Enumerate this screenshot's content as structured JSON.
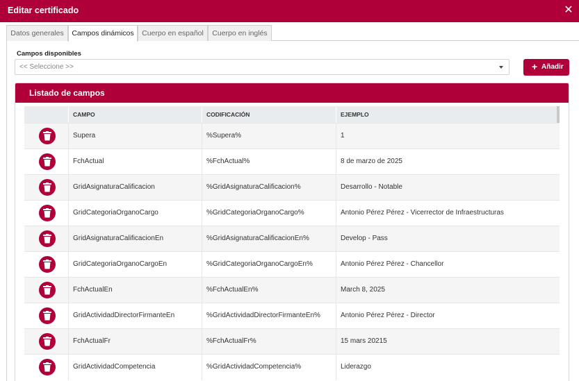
{
  "window": {
    "title": "Editar certificado",
    "close_glyph": "✕"
  },
  "tabs": [
    {
      "label": "Datos generales",
      "active": false
    },
    {
      "label": "Campos dinámicos",
      "active": true
    },
    {
      "label": "Cuerpo en español",
      "active": false
    },
    {
      "label": "Cuerpo en inglés",
      "active": false
    }
  ],
  "campos": {
    "label": "Campos disponibles",
    "selected": "<< Seleccione >>",
    "add_label": "Añadir",
    "add_icon": "plus-icon"
  },
  "listado": {
    "title": "Listado de campos",
    "columns": [
      "CAMPO",
      "CODIFICACIÓN",
      "EJEMPLO"
    ],
    "rows": [
      {
        "campo": "Supera",
        "codificacion": "%Supera%",
        "ejemplo": "1"
      },
      {
        "campo": "FchActual",
        "codificacion": "%FchActual%",
        "ejemplo": "8 de marzo de 2025"
      },
      {
        "campo": "GridAsignaturaCalificacion",
        "codificacion": "%GridAsignaturaCalificacion%",
        "ejemplo": "Desarrollo - Notable"
      },
      {
        "campo": "GridCategoriaOrganoCargo",
        "codificacion": "%GridCategoriaOrganoCargo%",
        "ejemplo": "Antonio Pérez Pérez - Vicerrector de Infraestructuras"
      },
      {
        "campo": "GridAsignaturaCalificacionEn",
        "codificacion": "%GridAsignaturaCalificacionEn%",
        "ejemplo": "Develop - Pass"
      },
      {
        "campo": "GridCategoriaOrganoCargoEn",
        "codificacion": "%GridCategoriaOrganoCargoEn%",
        "ejemplo": "Antonio Pérez Pérez - Chancellor"
      },
      {
        "campo": "FchActualEn",
        "codificacion": "%FchActualEn%",
        "ejemplo": "March 8, 2025"
      },
      {
        "campo": "GridActividadDirectorFirmanteEn",
        "codificacion": "%GridActividadDirectorFirmanteEn%",
        "ejemplo": "Antonio Pérez Pérez - Director"
      },
      {
        "campo": "FchActualFr",
        "codificacion": "%FchActualFr%",
        "ejemplo": "15 mars 20215"
      },
      {
        "campo": "GridActividadCompetencia",
        "codificacion": "%GridActividadCompetencia%",
        "ejemplo": "Liderazgo"
      }
    ],
    "delete_icon": "trash-icon"
  },
  "colors": {
    "brand": "#b0003a",
    "header_bg": "#e9ecef",
    "row_alt": "#f5f5f5"
  }
}
